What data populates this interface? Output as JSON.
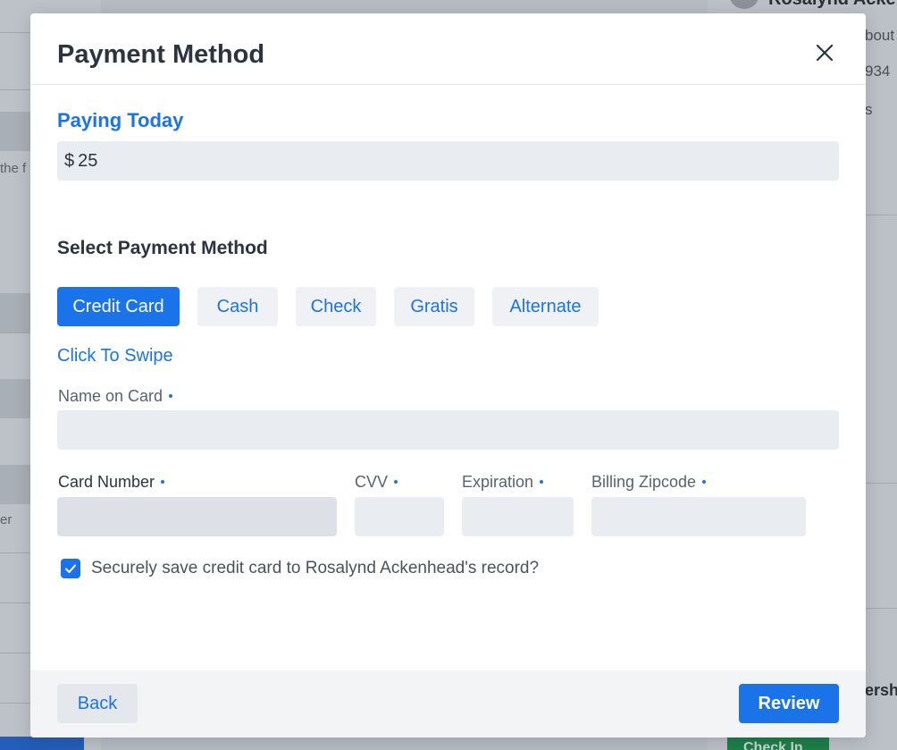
{
  "background": {
    "left_text_1": "the f",
    "left_text_2": "er",
    "right_name": "Rosalynd Ackenhead",
    "right_text_1": "bout",
    "right_text_2": "934",
    "right_text_3": "s",
    "right_heading": "ersh",
    "right_button": "Check In"
  },
  "modal": {
    "title": "Payment Method",
    "close_icon": "close-icon",
    "paying_today": {
      "label": "Paying Today",
      "currency": "$",
      "amount": "25"
    },
    "select_payment_method_label": "Select Payment Method",
    "payment_methods": [
      {
        "label": "Credit Card",
        "selected": true
      },
      {
        "label": "Cash",
        "selected": false
      },
      {
        "label": "Check",
        "selected": false
      },
      {
        "label": "Gratis",
        "selected": false
      },
      {
        "label": "Alternate",
        "selected": false
      }
    ],
    "swipe_link": "Click To Swipe",
    "fields": {
      "name_on_card": {
        "label": "Name on Card",
        "value": ""
      },
      "card_number": {
        "label": "Card Number",
        "value": ""
      },
      "cvv": {
        "label": "CVV",
        "value": ""
      },
      "expiration": {
        "label": "Expiration",
        "value": ""
      },
      "billing_zipcode": {
        "label": "Billing Zipcode",
        "value": ""
      }
    },
    "save_card": {
      "checked": true,
      "label": "Securely save credit card to Rosalynd Ackenhead's record?"
    },
    "footer": {
      "back_label": "Back",
      "review_label": "Review"
    }
  },
  "colors": {
    "accent": "#1a73e8",
    "title_text": "#2b3440",
    "input_bg": "#e9ecf0",
    "footer_bg": "#f3f4f6"
  }
}
